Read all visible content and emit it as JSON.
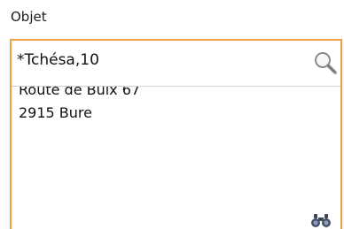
{
  "field": {
    "label": "Objet",
    "search_value": "*Tchésa,10"
  },
  "result": {
    "line1": "Route de Buix 67",
    "line2": "2915 Bure"
  },
  "icons": {
    "search": "search-icon",
    "binoculars": "binoculars-icon"
  },
  "colors": {
    "accent_border": "#f0a040"
  }
}
